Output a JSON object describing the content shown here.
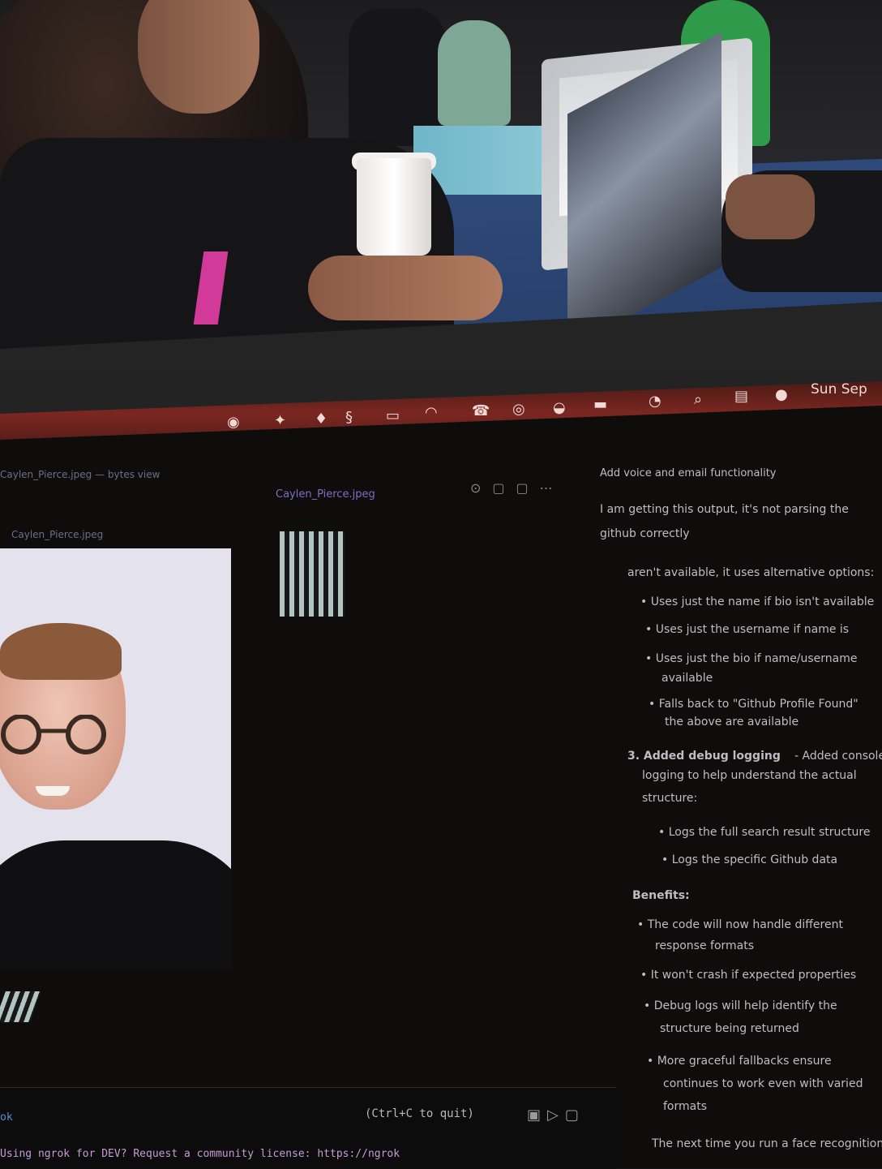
{
  "menubar": {
    "date": "Sun Sep"
  },
  "editor": {
    "file_path": "Caylen_Pierce.jpeg — bytes view",
    "breadcrumb": "Caylen_Pierce.jpeg",
    "active_tab": "Caylen_Pierce.jpeg"
  },
  "chat": {
    "title": "Add voice and email functionality",
    "user_message_1": "I am getting this output, it's not parsing the",
    "user_message_2": "github correctly",
    "intro": "aren't available, it uses alternative options:",
    "bullets_a": [
      "Uses just the name if bio isn't available",
      "Uses just the username if name is",
      "Uses just the bio if name/username",
      "available",
      "Falls back to \"Github Profile Found\"",
      "the above are available"
    ],
    "step3_heading": "3. Added debug logging",
    "step3_text": " - Added console",
    "step3_text2": "logging to help understand the actual",
    "step3_text3": "structure:",
    "bullets_b": [
      "Logs the full search result structure",
      "Logs the specific Github data"
    ],
    "benefits_heading": "Benefits:",
    "benefits": [
      "The code will now handle different",
      "response formats",
      "It won't crash if expected properties",
      "Debug logs will help identify the",
      "structure being returned",
      "More graceful fallbacks ensure",
      "continues to work even with varied",
      "formats"
    ],
    "closing": "The next time you run a face recognition"
  },
  "terminal": {
    "quit_hint": "(Ctrl+C to quit)",
    "prompt": "ok",
    "log_line": "Using ngrok for DEV? Request a community license: https://ngrok"
  }
}
